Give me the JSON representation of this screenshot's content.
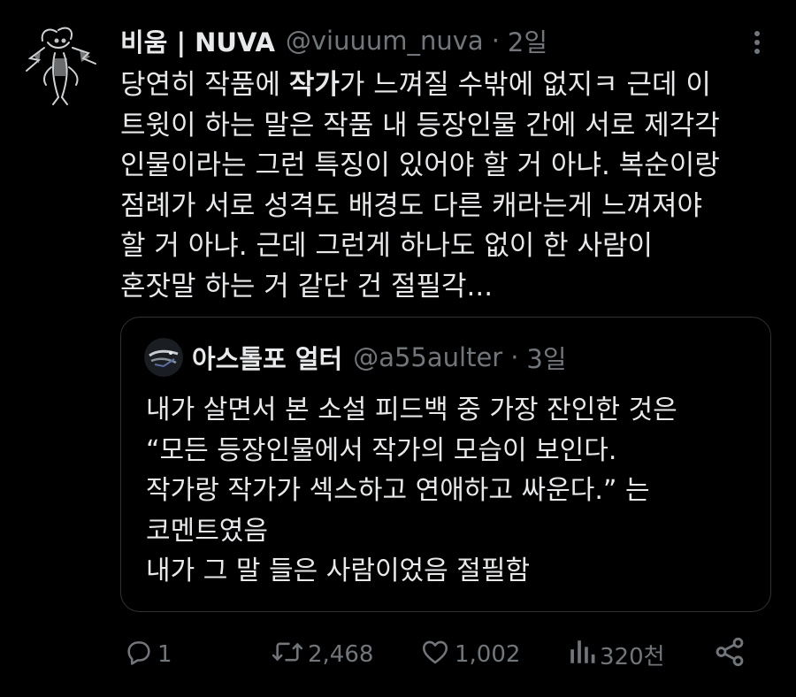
{
  "tweet": {
    "display_name": "비움 | NUVA",
    "handle": "@viuuum_nuva",
    "separator": "·",
    "time": "2일",
    "text_lines": [
      [
        "당연히 작품에 ",
        "작가",
        "가 느껴질 수밖에 없지ㅋ 근데 이"
      ],
      [
        "트윗이 하는 말은 작품 내 등장인물 간에 서로 제각각"
      ],
      [
        "인물이라는 그런 특징이 있어야 할 거 아냐. 복순이랑"
      ],
      [
        "점례가 서로 성격도 배경도 다른 캐라는게 느껴져야"
      ],
      [
        "할 거 아냐. 근데 그런게 하나도 없이 한 사람이"
      ],
      [
        "혼잣말 하는 거 같단 건 절필각..."
      ]
    ]
  },
  "quote": {
    "display_name": "아스톨포 얼터",
    "handle": "@a55aulter",
    "separator": "·",
    "time": "3일",
    "text_lines": [
      "내가 살면서 본 소설 피드백 중 가장 잔인한 것은",
      "“모든 등장인물에서 작가의 모습이 보인다.",
      "작가랑 작가가 섹스하고 연애하고 싸운다.” 는",
      "코멘트였음",
      "내가 그 말 들은 사람이었음 절필함"
    ]
  },
  "actions": {
    "reply": {
      "icon": "reply-icon",
      "count": "1"
    },
    "retweet": {
      "icon": "retweet-icon",
      "count": "2,468"
    },
    "like": {
      "icon": "heart-icon",
      "count": "1,002"
    },
    "views": {
      "icon": "views-icon",
      "count": "320천"
    },
    "share": {
      "icon": "share-icon"
    }
  },
  "colors": {
    "background": "#000000",
    "primary_text": "#e7e9ea",
    "secondary_text": "#71767b",
    "border": "#2f3336"
  }
}
